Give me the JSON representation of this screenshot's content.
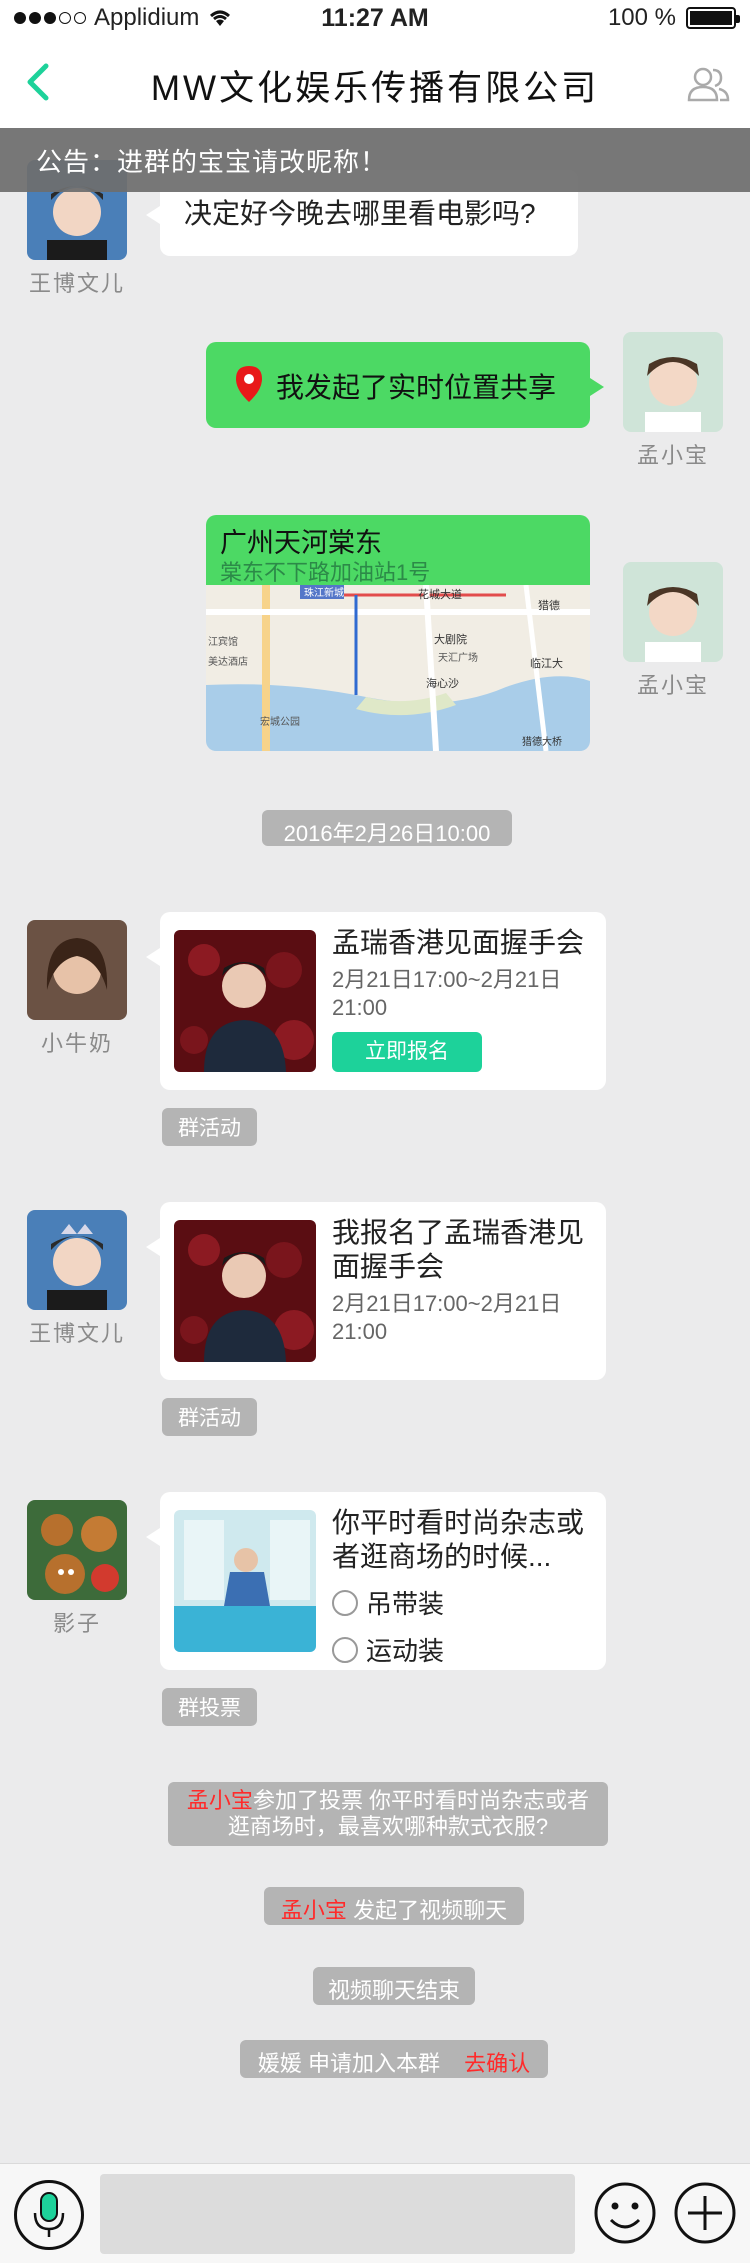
{
  "status_bar": {
    "carrier": "Applidium",
    "time": "11:27 AM",
    "battery": "100 %"
  },
  "header": {
    "title": "MW文化娱乐传播有限公司",
    "back_icon": "chevron-left-icon",
    "members_icon": "group-members-icon",
    "accent": "#1dd29a"
  },
  "notice": {
    "text": "公告：进群的宝宝请改昵称！"
  },
  "messages": [
    {
      "sender": "王博文儿",
      "text": "决定好今晚去哪里看电影吗?"
    },
    {
      "sender": "孟小宝",
      "text": "我发起了实时位置共享"
    },
    {
      "sender": "孟小宝",
      "location_title": "广州天河棠东",
      "location_address": "棠东不下路加油站1号",
      "map_labels": [
        "珠江新城",
        "花城大道",
        "猎德",
        "大剧院",
        "天汇广场",
        "海心沙",
        "临江大",
        "猎德大桥",
        "江宾馆",
        "美达酒店",
        "宏城公园"
      ]
    }
  ],
  "timestamp": "2016年2月26日10:00",
  "activities": [
    {
      "sender": "小牛奶",
      "title": "孟瑞香港见面握手会",
      "time": "2月21日17:00~2月21日21:00",
      "button": "立即报名",
      "tag": "群活动"
    },
    {
      "sender": "王博文儿",
      "title": "我报名了孟瑞香港见面握手会",
      "time": "2月21日17:00~2月21日21:00",
      "tag": "群活动"
    }
  ],
  "poll": {
    "sender": "影子",
    "title": "你平时看时尚杂志或者逛商场的时候...",
    "options": [
      "吊带装",
      "运动装"
    ],
    "tag": "群投票"
  },
  "system": {
    "vote": {
      "user": "孟小宝",
      "text": "参加了投票 你平时看时尚杂志或者逛商场时，最喜欢哪种款式衣服?"
    },
    "video_start": {
      "user": "孟小宝",
      "text": "发起了视频聊天"
    },
    "video_end": "视频聊天结束",
    "join": {
      "text": "媛媛 申请加入本群",
      "action": "去确认"
    }
  },
  "toolbar": {
    "mic_icon": "microphone-icon",
    "emoji_icon": "emoji-icon",
    "plus_icon": "plus-icon"
  }
}
